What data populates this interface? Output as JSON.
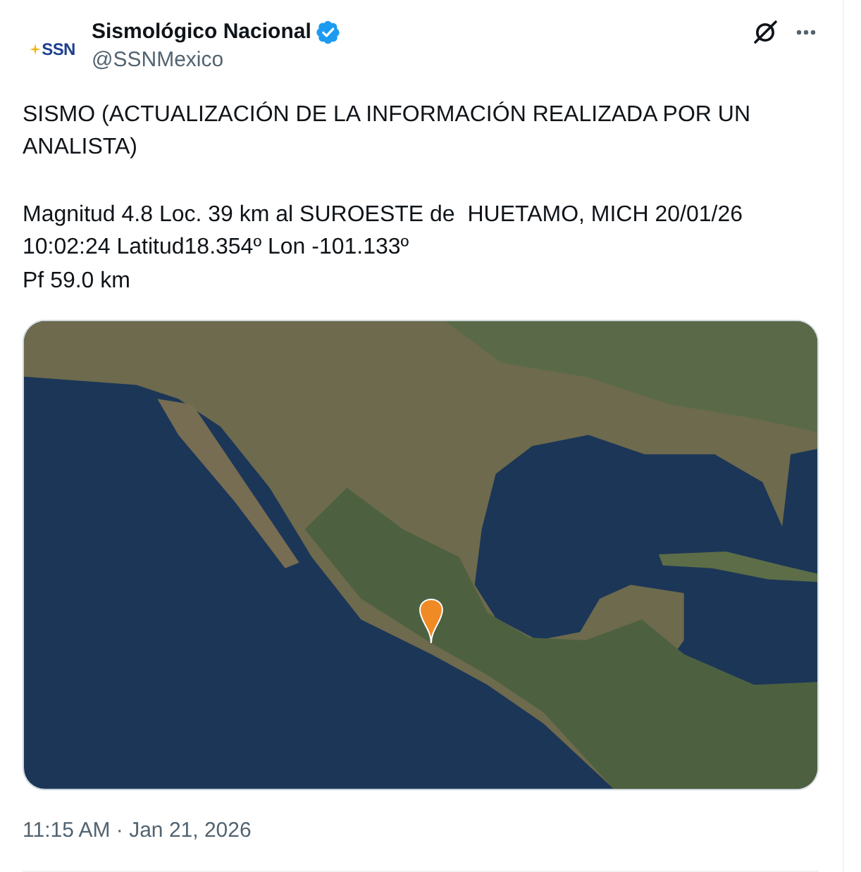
{
  "author": {
    "logo_text": "SSN",
    "name": "Sismológico Nacional",
    "verified": true,
    "handle": "@SSNMexico"
  },
  "tweet": {
    "paragraphs": [
      "SISMO (ACTUALIZACIÓN DE LA INFORMACIÓN REALIZADA POR UN\nANALISTA)",
      "Magnitud 4.8 Loc. 39 km al SUROESTE de  HUETAMO, MICH 20/01/26\n10:02:24 Latitud18.354º Lon -101.133º\nPf 59.0 km"
    ]
  },
  "media": {
    "kind": "map"
  },
  "timestamp": "11:15 AM · Jan 21, 2026"
}
